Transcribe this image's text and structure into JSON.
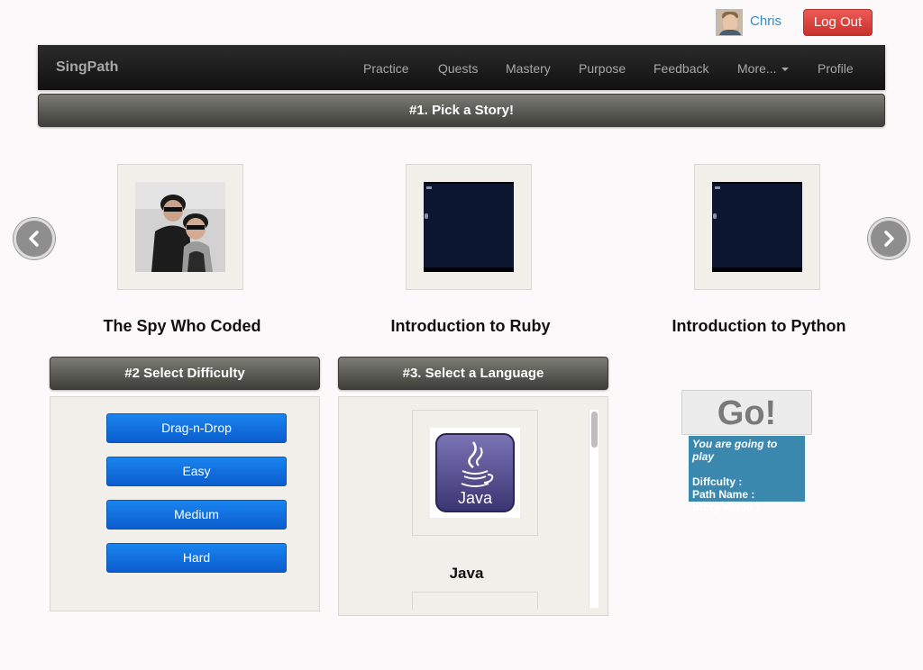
{
  "user": {
    "name": "Chris",
    "logout_label": "Log Out"
  },
  "navbar": {
    "brand": "SingPath",
    "items": [
      "Practice",
      "Quests",
      "Mastery",
      "Purpose",
      "Feedback",
      "More...",
      "Profile"
    ]
  },
  "story": {
    "header": "#1. Pick a Story!",
    "items": [
      {
        "title": "The Spy Who Coded"
      },
      {
        "title": "Introduction to Ruby"
      },
      {
        "title": "Introduction to Python"
      }
    ]
  },
  "difficulty": {
    "header": "#2 Select Difficulty",
    "options": [
      "Drag-n-Drop",
      "Easy",
      "Medium",
      "Hard"
    ]
  },
  "language": {
    "header": "#3. Select a Language",
    "items": [
      {
        "name": "Java",
        "logo_text": "Java"
      }
    ]
  },
  "go": {
    "label": "Go!",
    "intro": "You are going to play",
    "difficulty_label": "Diffculty :",
    "path_label": "Path Name :",
    "story_label": "Story Name :"
  },
  "colors": {
    "logout": "#d9534f",
    "difficulty_button": "#0a6fe0",
    "info_box": "#3a88ae",
    "link": "#2f8fc7"
  }
}
